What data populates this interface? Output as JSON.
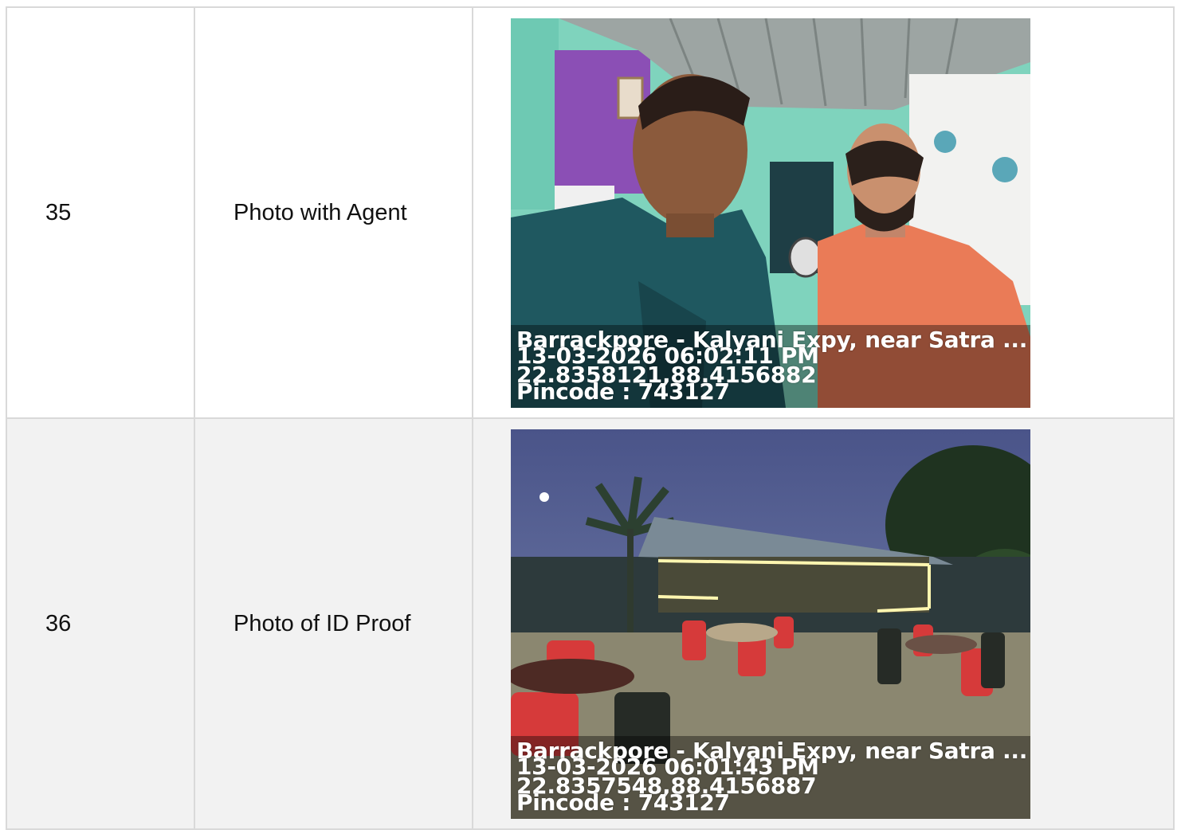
{
  "rows": [
    {
      "number": "35",
      "label": "Photo with Agent",
      "photo": {
        "subject": "selfie-two-men-indoor",
        "stamp": {
          "address": "Barrackpore - Kalyani Expy, near Satra ...",
          "datetime": "13-03-2026 06:02:11 PM",
          "coordinates": "22.8358121,88.4156882",
          "pincode": "Pincode : 743127"
        }
      }
    },
    {
      "number": "36",
      "label": "Photo of ID Proof",
      "photo": {
        "subject": "outdoor-restaurant-at-dusk",
        "stamp": {
          "address": "Barrackpore - Kalyani Expy, near Satra ...",
          "datetime": "13-03-2026 06:01:43 PM",
          "coordinates": "22.8357548,88.4156887",
          "pincode": "Pincode : 743127"
        }
      }
    }
  ]
}
